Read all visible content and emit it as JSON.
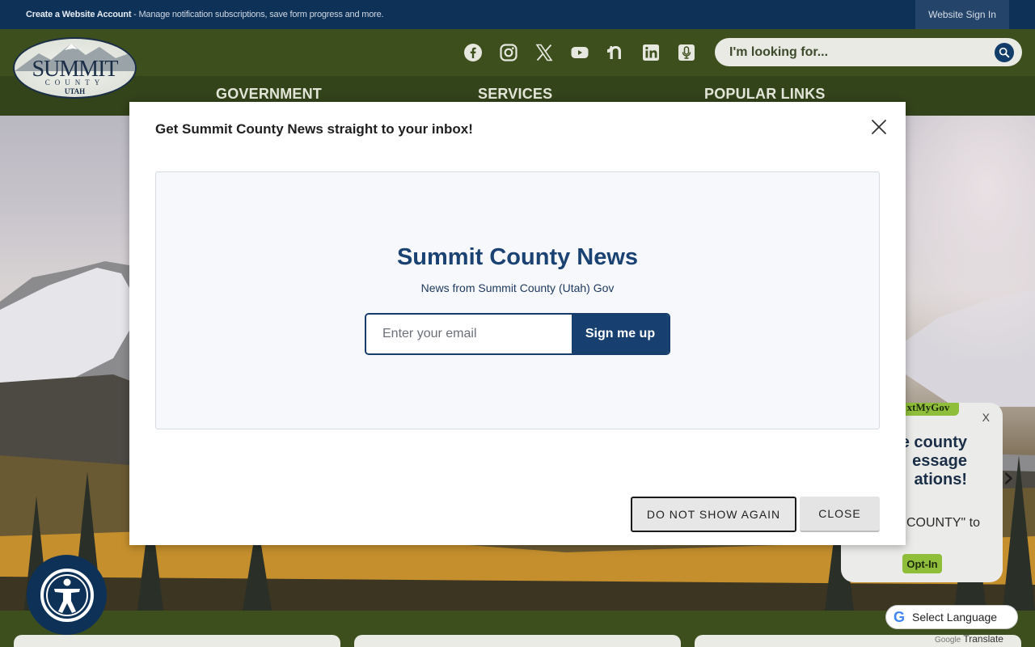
{
  "topbar": {
    "account_link": "Create a Website Account",
    "account_desc": " - Manage notification subscriptions, save form progress and more.",
    "sign_in": "Website Sign In"
  },
  "logo": {
    "line1": "SUMMIT",
    "line2": "COUNTY",
    "line3": "UTAH"
  },
  "social": [
    "facebook-icon",
    "instagram-icon",
    "x-icon",
    "youtube-icon",
    "nextdoor-icon",
    "linkedin-icon",
    "podcast-icon"
  ],
  "search": {
    "placeholder": "I'm looking for..."
  },
  "nav": {
    "government": "GOVERNMENT",
    "services": "SERVICES",
    "popular": "POPULAR LINKS"
  },
  "modal": {
    "title": "Get Summit County News straight to your inbox!",
    "newsletter_title": "Summit County News",
    "newsletter_sub": "News from Summit County (Utah) Gov",
    "email_placeholder": "Enter your email",
    "signup_label": "Sign me up",
    "do_not_show": "DO NOT SHOW AGAIN",
    "close": "CLOSE"
  },
  "textmygov": {
    "brand": "xtMyGov",
    "close": "X",
    "headline_1": "e county",
    "headline_2": "essage",
    "headline_3": "ations!",
    "body": "COUNTY\" to",
    "opt_in": "Opt-In"
  },
  "translate": {
    "label": "Select Language",
    "powered_by_brand": "Google",
    "powered_by": "Translate"
  },
  "colors": {
    "navy": "#0e3158",
    "olive": "#3d4f1d",
    "accent_blue": "#173f6f",
    "textmygov_green": "#8fbf3a"
  }
}
